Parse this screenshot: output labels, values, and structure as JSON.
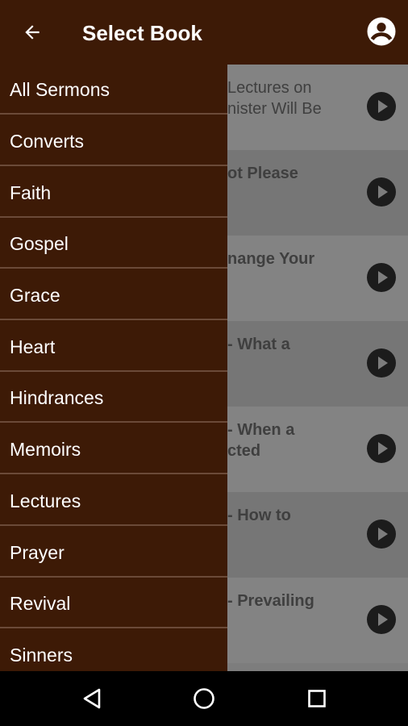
{
  "appbar": {
    "title": "Select Book"
  },
  "drawer": {
    "items": [
      "All Sermons",
      "Converts",
      "Faith",
      "Gospel",
      "Grace",
      "Heart",
      "Hindrances",
      "Memoirs",
      "Lectures",
      "Prayer",
      "Revival",
      "Sinners"
    ]
  },
  "list": {
    "rows": [
      {
        "line1": "Lectures on",
        "line2": "nister Will Be"
      },
      {
        "line1": "ot Please",
        "line2": ""
      },
      {
        "line1": "nange Your",
        "line2": ""
      },
      {
        "line1": " - What a",
        "line2": ""
      },
      {
        "line1": " - When a",
        "line2": "cted"
      },
      {
        "line1": " - How to",
        "line2": ""
      },
      {
        "line1": " - Prevailing",
        "line2": ""
      }
    ]
  },
  "icons": {
    "back": "arrow-left-icon",
    "account": "account-circle-icon",
    "play": "play-circle-icon"
  },
  "colors": {
    "primary": "#3d1a06",
    "scrim": "#7d7d7d",
    "navbar": "#000000"
  }
}
